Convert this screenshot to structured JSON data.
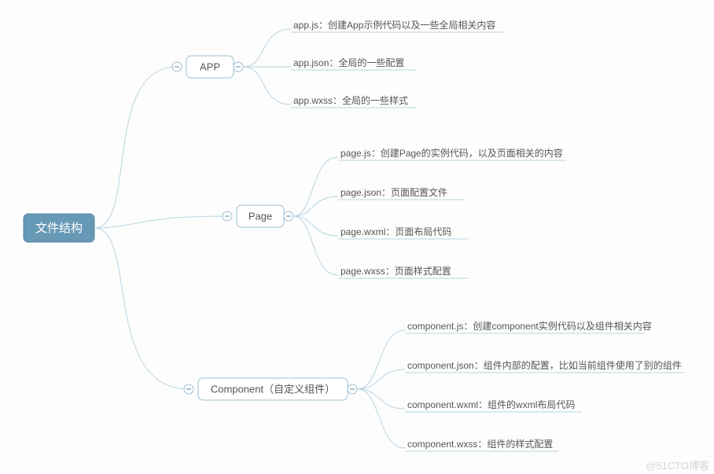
{
  "root": {
    "label": "文件结构"
  },
  "nodes": {
    "app": {
      "label": "APP"
    },
    "page": {
      "label": "Page"
    },
    "comp": {
      "label": "Component（自定义组件）"
    }
  },
  "leaves": {
    "app": [
      "app.js：创建App示例代码以及一些全局相关内容",
      "app.json：全局的一些配置",
      "app.wxss：全局的一些样式"
    ],
    "page": [
      "page.js：创建Page的实例代码，以及页面相关的内容",
      "page.json：页面配置文件",
      "page.wxml：页面布局代码",
      "page.wxss：页面样式配置"
    ],
    "comp": [
      "component.js：创建component实例代码以及组件相关内容",
      "component.json：组件内部的配置，比如当前组件使用了别的组件",
      "component.wxml：组件的wxml布局代码",
      "component.wxss：组件的样式配置"
    ]
  },
  "watermark": "@51CTO博客"
}
